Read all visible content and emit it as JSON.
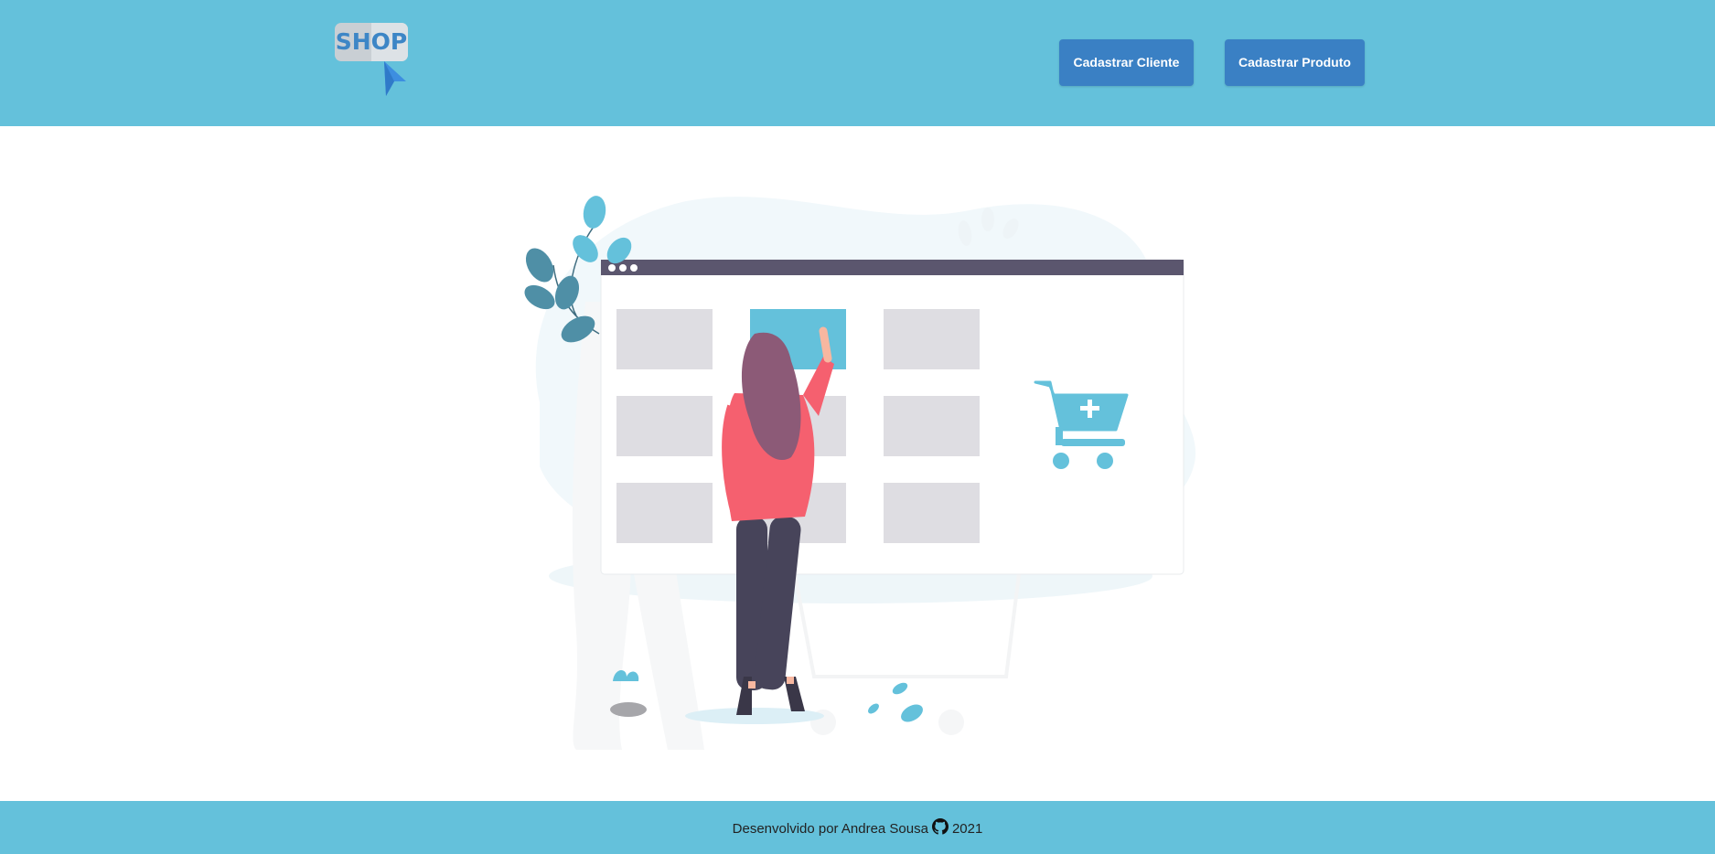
{
  "header": {
    "logo_text": "SHOP",
    "buttons": {
      "cadastrar_cliente": "Cadastrar Cliente",
      "cadastrar_produto": "Cadastrar Produto"
    }
  },
  "hero": {
    "icons": [
      "shopping-illustration",
      "add-to-cart-icon"
    ]
  },
  "footer": {
    "text_before": "Desenvolvido por Andrea Sousa",
    "icon": "github-icon",
    "year": "2021"
  },
  "colors": {
    "brand": "#64c1db",
    "button": "#3a80c4",
    "accent_pink": "#f5606f",
    "dark_slate": "#5b566e"
  }
}
